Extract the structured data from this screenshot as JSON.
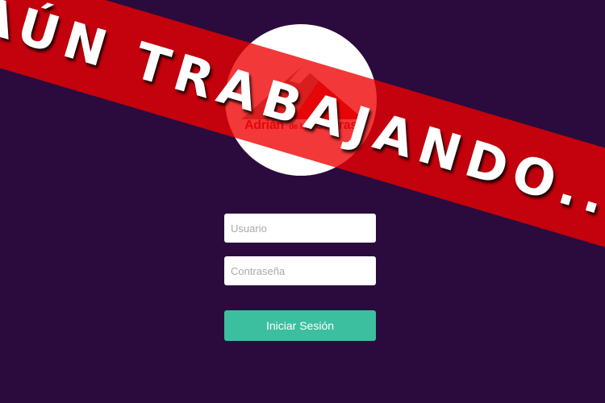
{
  "logo": {
    "name_main": "Adrián",
    "name_small": "de las",
    "name_end": "Sierras",
    "brand_color": "#c21d2a"
  },
  "form": {
    "username_placeholder": "Usuario",
    "password_placeholder": "Contraseña",
    "submit_label": "Iniciar Sesión",
    "submit_color": "#3bbf9e"
  },
  "banner": {
    "text": "AÚN TRABAJANDO...",
    "color": "#ee0000"
  },
  "theme": {
    "background": "#2b0b3d"
  }
}
